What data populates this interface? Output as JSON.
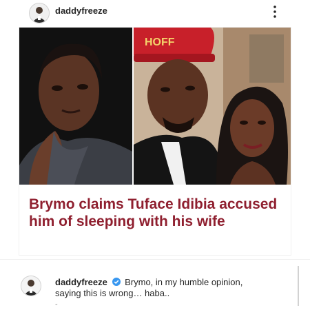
{
  "post": {
    "username": "daddyfreeze",
    "headline": "Brymo claims Tuface Idibia accused him of sleeping with his wife",
    "cap_text": "HOFF"
  },
  "comment": {
    "username": "daddyfreeze",
    "text_line1": "Brymo, in my humble opinion,",
    "text_line2": "saying this is wrong… haba..",
    "trailing": "-"
  },
  "colors": {
    "headline": "#8f1f2f",
    "verified": "#3897f0",
    "cap": "#c8202a"
  }
}
